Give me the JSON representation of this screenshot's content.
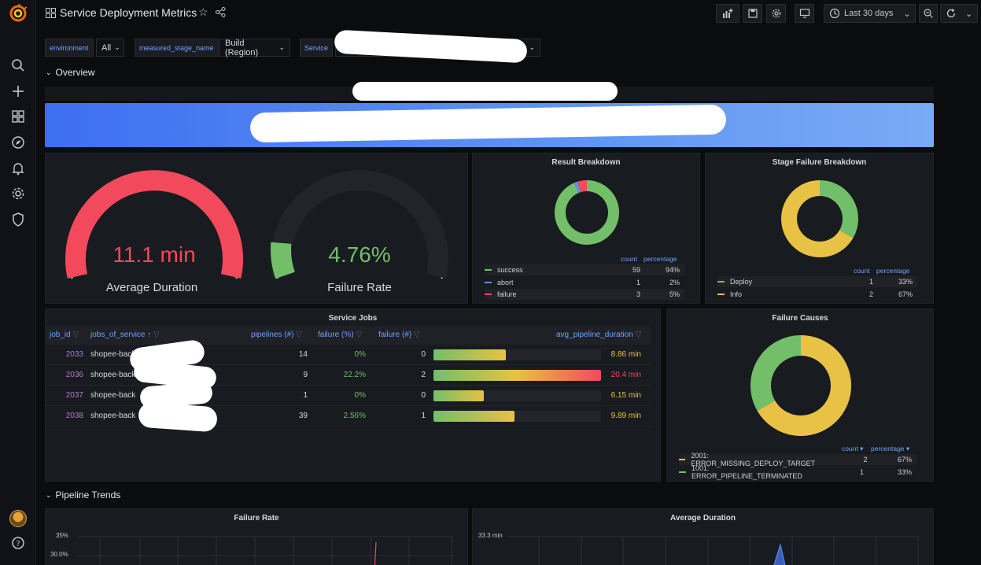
{
  "topbar": {
    "title": "Service Deployment Metrics",
    "time_range": "Last 30 days"
  },
  "variables": {
    "environment_label": "environment",
    "environment_value": "All",
    "stage_label": "measured_stage_name",
    "stage_value": "Build (Region)",
    "service_label": "Service"
  },
  "rows": {
    "overview": "Overview",
    "pipeline_trends": "Pipeline Trends"
  },
  "gauges": {
    "avg_duration": {
      "value": "11.1 min",
      "label": "Average Duration",
      "color": "#f2495c"
    },
    "failure_rate": {
      "value": "4.76%",
      "label": "Failure Rate",
      "color": "#73bf69",
      "fraction": 0.0476
    }
  },
  "result_breakdown": {
    "title": "Result Breakdown",
    "col_count": "count",
    "col_percentage": "percentage",
    "items": [
      {
        "name": "success",
        "count": "59",
        "pct": "94%",
        "color": "#73bf69"
      },
      {
        "name": "abort",
        "count": "1",
        "pct": "2%",
        "color": "#5794f2"
      },
      {
        "name": "failure",
        "count": "3",
        "pct": "5%",
        "color": "#f2495c"
      }
    ]
  },
  "stage_failure": {
    "title": "Stage Failure Breakdown",
    "col_count": "count",
    "col_percentage": "percentage",
    "items": [
      {
        "name": "Deploy",
        "count": "1",
        "pct": "33%",
        "color": "#73bf69"
      },
      {
        "name": "Info",
        "count": "2",
        "pct": "67%",
        "color": "#e8c244"
      }
    ]
  },
  "service_jobs": {
    "title": "Service Jobs",
    "headers": {
      "job_id": "job_id",
      "jobs_of_service": "jobs_of_service",
      "pipelines": "pipelines (#)",
      "failure_pct": "failure (%)",
      "failure_num": "failure (#)",
      "avg_duration": "avg_pipeline_duration"
    },
    "rows": [
      {
        "job_id": "2033",
        "name": "shopee-back",
        "pipelines": "14",
        "failure_pct": "0%",
        "failure_num": "0",
        "duration": "8.86 min",
        "fill": 0.434,
        "dur_color": "#e8c244"
      },
      {
        "job_id": "2036",
        "name": "shopee-back",
        "pipelines": "9",
        "failure_pct": "22.2%",
        "failure_num": "2",
        "duration": "20.4 min",
        "fill": 1.0,
        "dur_color": "#f2495c"
      },
      {
        "job_id": "2037",
        "name": "shopee-back",
        "pipelines": "1",
        "failure_pct": "0%",
        "failure_num": "0",
        "duration": "6.15 min",
        "fill": 0.301,
        "dur_color": "#e8c244"
      },
      {
        "job_id": "2038",
        "name": "shopee-back",
        "pipelines": "39",
        "failure_pct": "2.56%",
        "failure_num": "1",
        "duration": "9.89 min",
        "fill": 0.485,
        "dur_color": "#e8c244"
      }
    ]
  },
  "failure_causes": {
    "title": "Failure Causes",
    "col_count": "count",
    "col_percentage": "percentage",
    "items": [
      {
        "name": "2001: ERROR_MISSING_DEPLOY_TARGET",
        "count": "2",
        "pct": "67%",
        "color": "#e8c244"
      },
      {
        "name": "1001: ERROR_PIPELINE_TERMINATED",
        "count": "1",
        "pct": "33%",
        "color": "#73bf69"
      }
    ]
  },
  "trend_failure": {
    "title": "Failure Rate",
    "tick_top": "35%",
    "tick_2": "30.0%"
  },
  "trend_duration": {
    "title": "Average Duration",
    "tick_top": "33.3 min"
  },
  "colors": {
    "accent": "#6fa2ff",
    "green": "#73bf69",
    "red": "#f2495c",
    "yellow": "#e8c244",
    "blue": "#5794f2"
  }
}
